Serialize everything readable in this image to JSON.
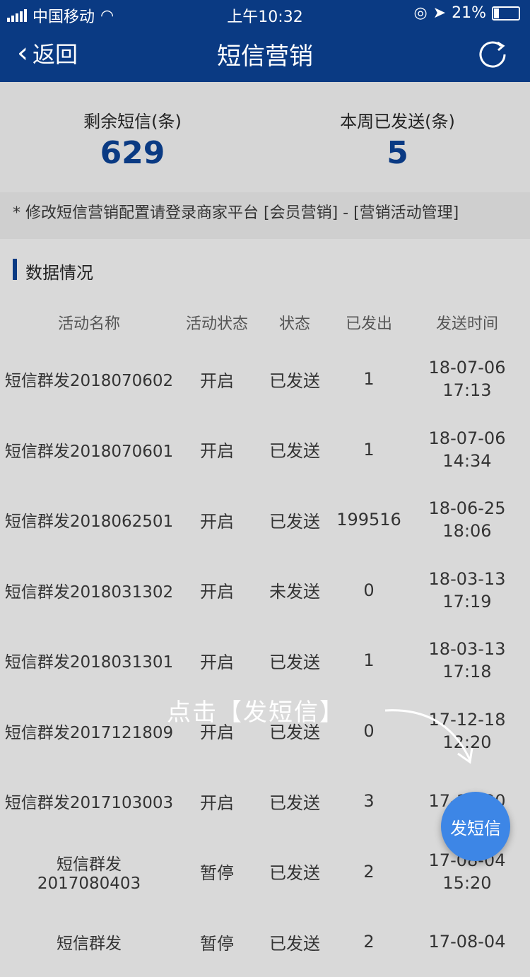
{
  "statusbar": {
    "carrier": "中国移动",
    "time": "上午10:32",
    "battery": "21%"
  },
  "nav": {
    "back_label": "返回",
    "title": "短信营销"
  },
  "summary": {
    "remaining_label": "剩余短信(条)",
    "remaining_value": "629",
    "week_sent_label": "本周已发送(条)",
    "week_sent_value": "5"
  },
  "notice": "* 修改短信营销配置请登录商家平台 [会员营销] - [营销活动管理]",
  "section_title": "数据情况",
  "table": {
    "headers": [
      "活动名称",
      "活动状态",
      "状态",
      "已发出",
      "发送时间"
    ],
    "rows": [
      {
        "name": "短信群发2018070602",
        "act": "开启",
        "status": "已发送",
        "sent": "1",
        "date": "18-07-06",
        "time": "17:13"
      },
      {
        "name": "短信群发2018070601",
        "act": "开启",
        "status": "已发送",
        "sent": "1",
        "date": "18-07-06",
        "time": "14:34"
      },
      {
        "name": "短信群发2018062501",
        "act": "开启",
        "status": "已发送",
        "sent": "199516",
        "date": "18-06-25",
        "time": "18:06"
      },
      {
        "name": "短信群发2018031302",
        "act": "开启",
        "status": "未发送",
        "sent": "0",
        "date": "18-03-13",
        "time": "17:19"
      },
      {
        "name": "短信群发2018031301",
        "act": "开启",
        "status": "已发送",
        "sent": "1",
        "date": "18-03-13",
        "time": "17:18"
      },
      {
        "name": "短信群发2017121809",
        "act": "开启",
        "status": "已发送",
        "sent": "0",
        "date": "17-12-18",
        "time": "12:20"
      },
      {
        "name": "短信群发2017103003",
        "act": "开启",
        "status": "已发送",
        "sent": "3",
        "date": "17-10-30",
        "time": ""
      },
      {
        "name": "短信群发 2017080403",
        "act": "暂停",
        "status": "已发送",
        "sent": "2",
        "date": "17-08-04",
        "time": "15:20"
      },
      {
        "name": "短信群发",
        "act": "暂停",
        "status": "已发送",
        "sent": "2",
        "date": "17-08-04",
        "time": ""
      }
    ]
  },
  "overlay": {
    "hint": "点击【发短信】"
  },
  "fab": {
    "label": "发短信"
  }
}
